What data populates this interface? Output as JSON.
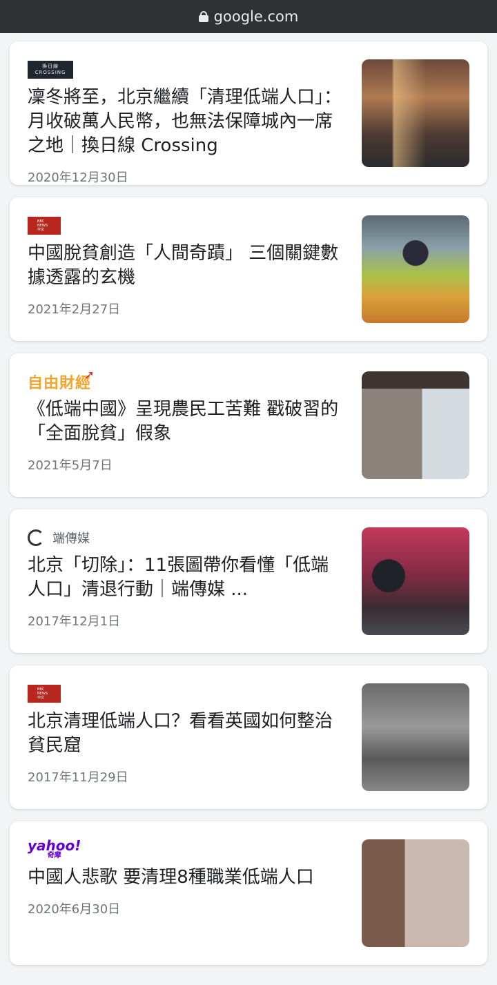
{
  "address_bar": {
    "domain": "google.com"
  },
  "articles": [
    {
      "source": "換日線 Crossing",
      "logo_lines": [
        "換日線",
        "CROSSING"
      ],
      "title": "凜冬將至，北京繼續「清理低端人口」：月收破萬人民幣，也無法保障城內一席之地｜換日線 Crossing",
      "date": "2020年12月30日"
    },
    {
      "source": "BBC News 中文",
      "logo_lines": [
        "BBC",
        "NEWS",
        "中文"
      ],
      "title": "中國脫貧創造「人間奇蹟」 三個關鍵數據透露的玄機",
      "date": "2021年2月27日"
    },
    {
      "source": "自由財經",
      "logo_text": "自由財經",
      "title": "《低端中國》呈現農民工苦難 戳破習的「全面脫貧」假象",
      "date": "2021年5月7日"
    },
    {
      "source": "端傳媒",
      "source_name": "端傳媒",
      "title": "北京「切除」：11張圖帶你看懂「低端人口」清退行動｜端傳媒 ...",
      "date": "2017年12月1日"
    },
    {
      "source": "BBC News 中文",
      "logo_lines": [
        "BBC",
        "NEWS",
        "中文"
      ],
      "title": "北京清理低端人口？看看英國如何整治貧民窟",
      "date": "2017年11月29日"
    },
    {
      "source": "Yahoo奇摩",
      "logo_lines": [
        "yahoo!",
        "奇摩"
      ],
      "title": "中國人悲歌 要清理8種職業低端人口",
      "date": "2020年6月30日"
    }
  ]
}
